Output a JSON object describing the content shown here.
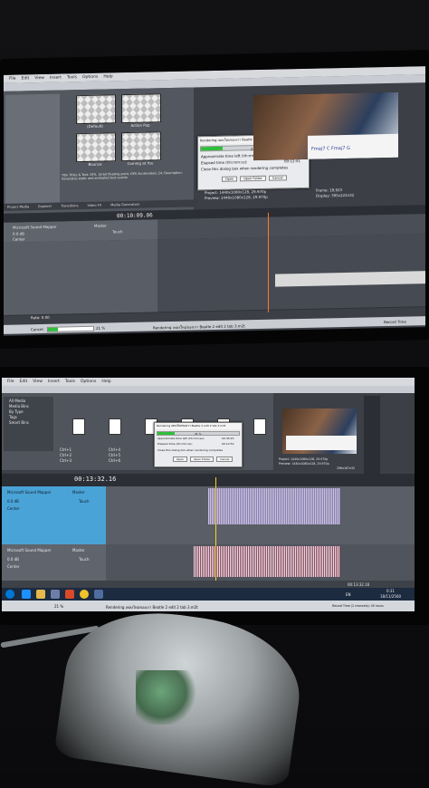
{
  "top_screen": {
    "menu": [
      "File",
      "Edit",
      "View",
      "Insert",
      "Tools",
      "Options",
      "Help"
    ],
    "generators": [
      {
        "label": "(Default)"
      },
      {
        "label": "Action Pop"
      },
      {
        "label": "Bounce"
      },
      {
        "label": "Coming at You"
      }
    ],
    "generator_description": "Title Titles & Text: OFX, 32-bit floating point, GPU Accelerated, 24; Description: Generates static and animated text events",
    "tabs": [
      "Project Media",
      "Explorer",
      "Transitions",
      "Video FX",
      "Media Generators"
    ],
    "render_dialog": {
      "title": "Rendering เพลงใหม่ของเรา Beatle 2 edit 2 tab 3.m2t",
      "percent": "21 %",
      "progress": 0.21,
      "remaining_label": "Approximate time left (hh:mm:ss):",
      "remaining": "00:45:45",
      "elapsed_label": "Elapsed time (hh:mm:ss):",
      "elapsed": "00:12:51",
      "close_checkbox": "Close this dialog box when rendering completes",
      "buttons": [
        "Open",
        "Open Folder",
        "Cancel"
      ]
    },
    "project_info": {
      "project": "1440x1080x128, 29.970p",
      "preview": "1440x1080x128, 29.970p",
      "frame": "18,923",
      "display": "395x222x32"
    },
    "timecode": "00:10:09.06",
    "audio_track": {
      "name": "Microsoft Sound Mapper",
      "vol": "0.0 dB",
      "pan": "Center",
      "fx": "Master",
      "touch": "Touch"
    },
    "rate": "Rate: 0.00",
    "status": {
      "cancel": "Cancel",
      "percent": "21 %",
      "message": "Rendering เพลงใหม่ของเรา Beatle 2 edit 2 tab 3.m2t",
      "record_time": "Record Time"
    },
    "chords": "Fmaj7  C  Fmaj7  G"
  },
  "bottom_screen": {
    "menu": [
      "File",
      "Edit",
      "View",
      "Insert",
      "Tools",
      "Options",
      "Help"
    ],
    "tabs": [
      "Project Media",
      "Explorer",
      "Transitions",
      "Video FX",
      "Media Generators"
    ],
    "tree": [
      "All Media",
      "Media Bins",
      "By Type",
      "Tags",
      "Smart Bins"
    ],
    "render_dialog": {
      "title": "Rendering เพลงใหม่ของเรา Beatle 2 edit 2 tab 3.m2t",
      "percent": "21 %",
      "progress": 0.21,
      "remaining_label": "Approximate time left (hh:mm:ss):",
      "remaining": "00:45:45",
      "elapsed_label": "Elapsed time (hh:mm:ss):",
      "elapsed": "00:12:52",
      "close_checkbox": "Close this dialog box when rendering completes",
      "buttons": [
        "Open",
        "Open Folder",
        "Cancel"
      ]
    },
    "chord_labels": [
      "Ctrl+1",
      "Ctrl+2",
      "Ctrl+3",
      "Ctrl+4",
      "Ctrl+5",
      "Ctrl+6"
    ],
    "project_info": {
      "project": "1440x1080x128, 29.970p",
      "preview": "1440x1080x128, 29.970p",
      "display": "296x167x32"
    },
    "timecode": "00:13:32.16",
    "tracks": [
      {
        "name": "Microsoft Sound Mapper",
        "vol": "0.0 dB",
        "pan": "Center",
        "fx": "Master",
        "touch": "Touch"
      },
      {
        "name": "Microsoft Sound Mapper",
        "vol": "0.0 dB",
        "pan": "Center",
        "fx": "Master",
        "touch": "Touch"
      }
    ],
    "end_time": "00:13:32.16",
    "status": {
      "percent": "21 %",
      "message": "Rendering เพลงใหม่ของเรา Beatle 2 edit 2 tab 3.m2t",
      "record_time": "Record Time (2 channels): 45 hours"
    },
    "taskbar": {
      "language": "EN",
      "clock_time": "0:31",
      "clock_date": "18/11/2560"
    }
  },
  "colors": {
    "progress": "#2fbf3a",
    "timeline_bg": "#4a4e56",
    "wave_region": "#c9c3d9",
    "taskbar": "#1c2b40"
  }
}
